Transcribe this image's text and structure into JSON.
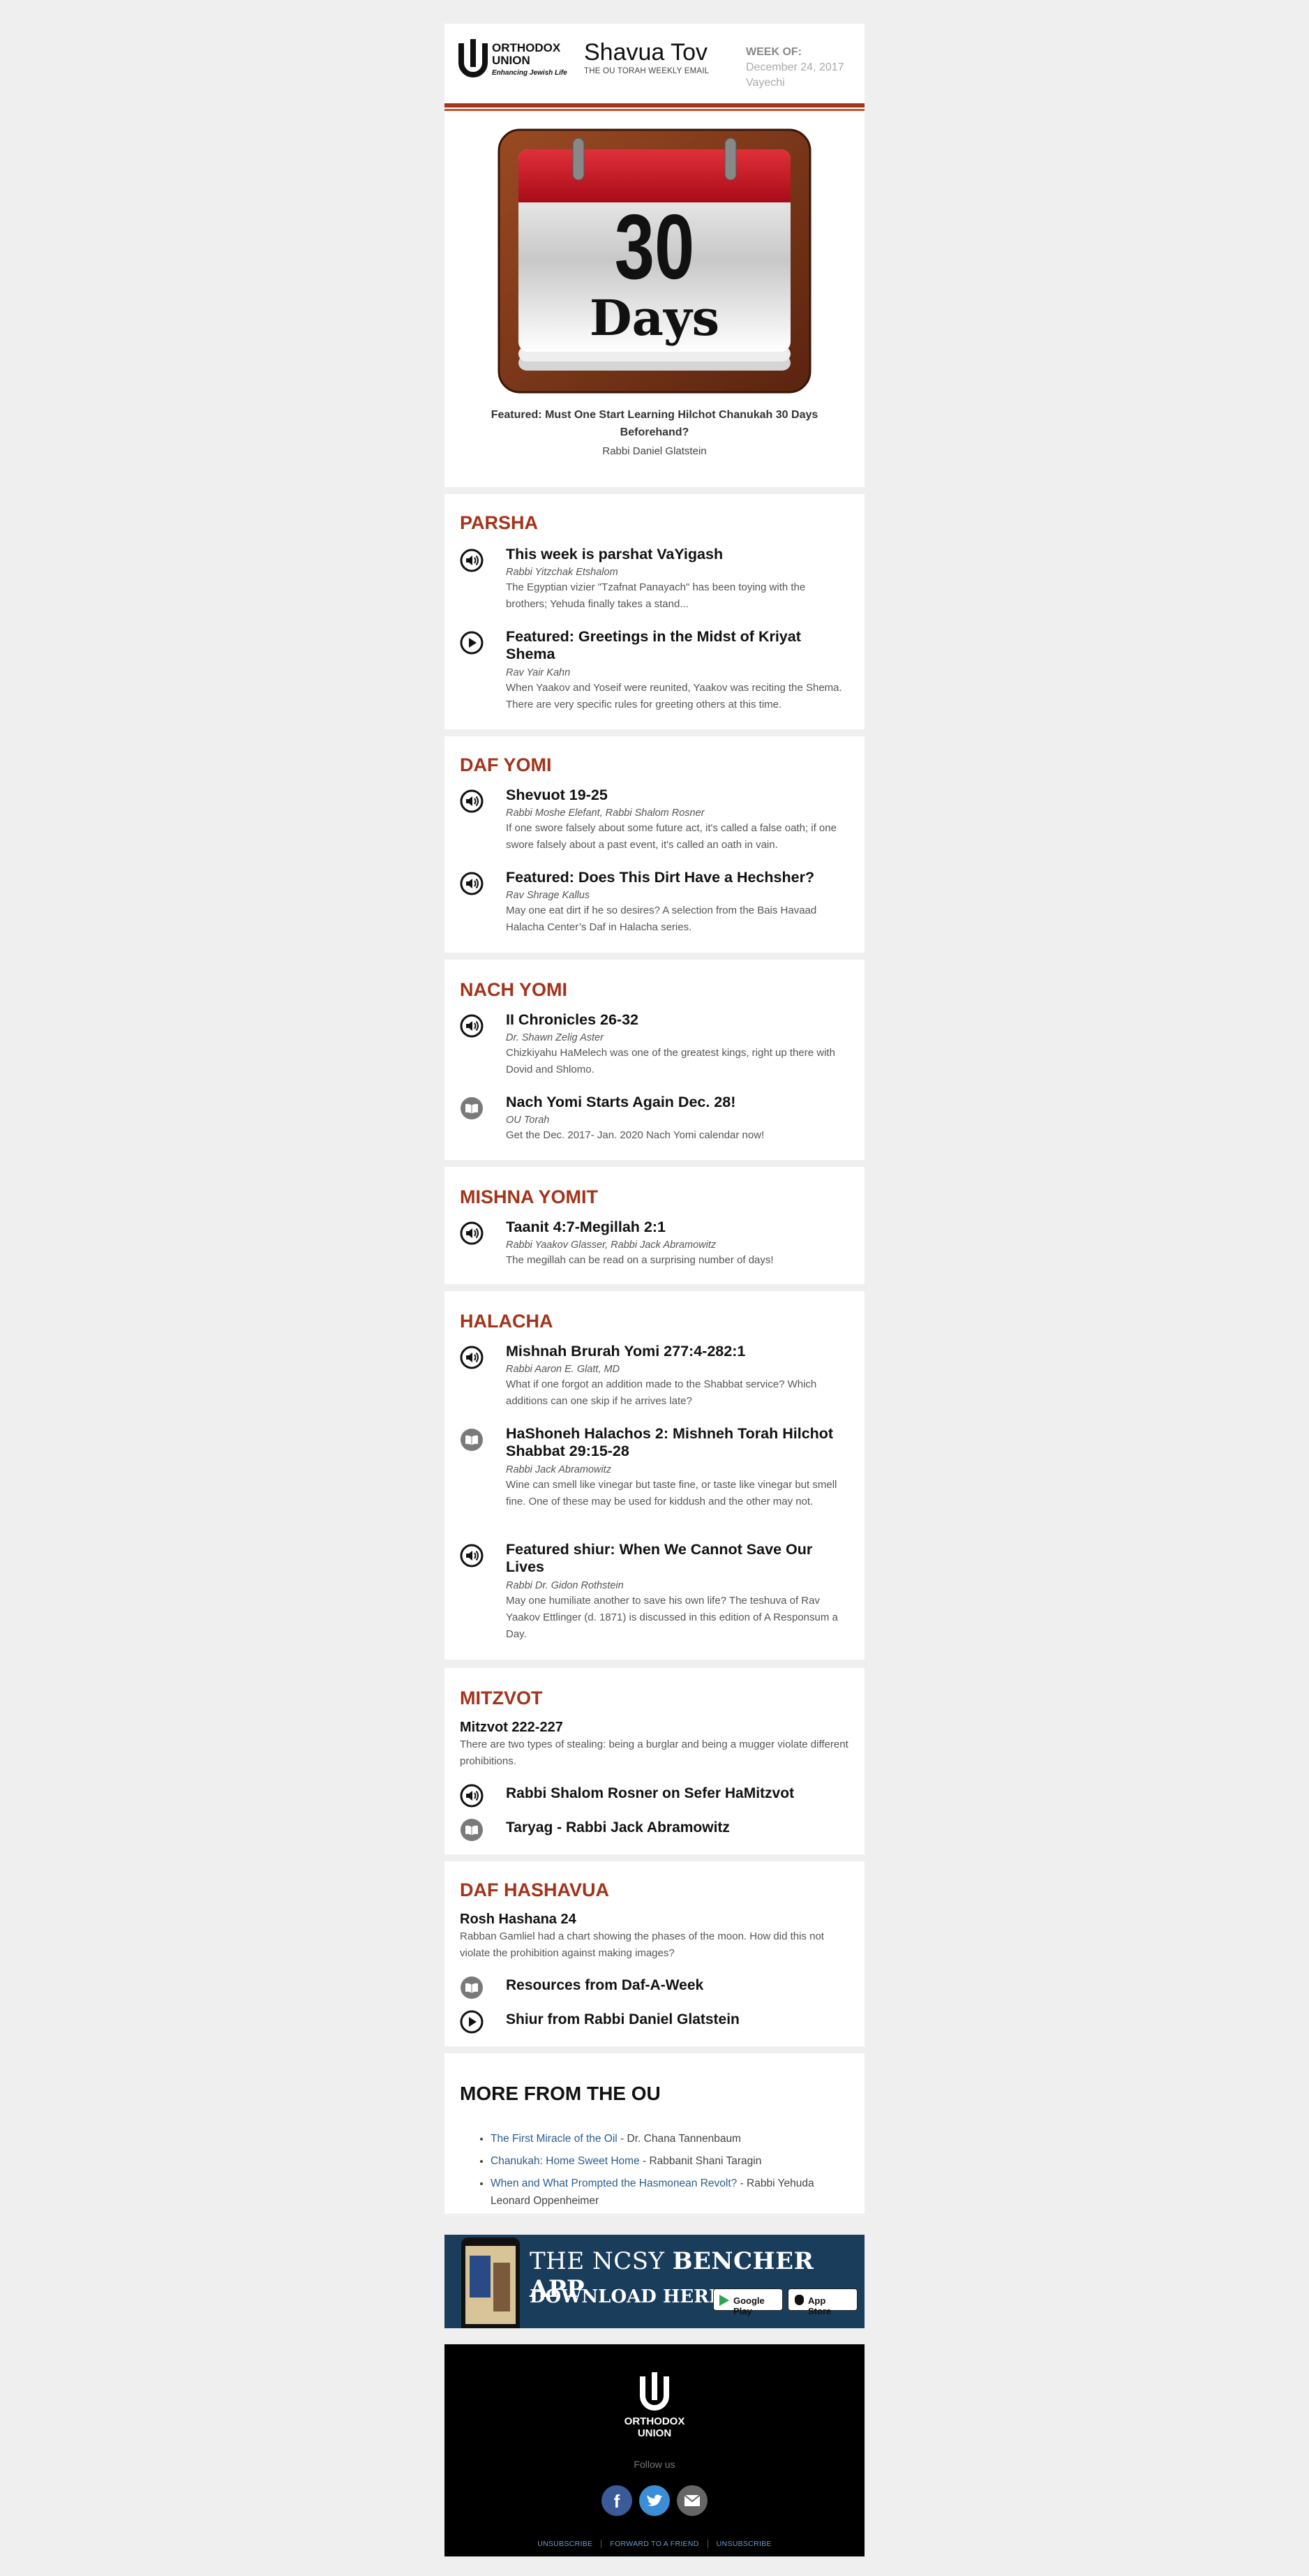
{
  "header": {
    "logo_line1": "ORTHODOX",
    "logo_line2": "UNION",
    "logo_tag": "Enhancing Jewish Life",
    "title": "Shavua Tov",
    "subtitle": "THE OU TORAH WEEKLY EMAIL",
    "week_label": "WEEK OF:",
    "week_date": "December 24, 2017",
    "week_parsha": "Vayechi"
  },
  "hero": {
    "number": "30",
    "word": "Days",
    "caption": "Featured: Must One Start Learning Hilchot Chanukah 30 Days Beforehand?",
    "author": "Rabbi Daniel Glatstein"
  },
  "sections": {
    "parsha": {
      "title": "PARSHA",
      "items": [
        {
          "icon": "audio-icon",
          "title": "This week is parshat VaYigash",
          "author": "Rabbi Yitzchak Etshalom",
          "desc": "The Egyptian vizier \"Tzafnat Panayach\" has been toying with the brothers; Yehuda finally takes a stand..."
        },
        {
          "icon": "play-icon",
          "title": "Featured: Greetings in the Midst of Kriyat Shema",
          "author": "Rav Yair Kahn",
          "desc": "When Yaakov and Yoseif were reunited, Yaakov was reciting the Shema. There are very specific rules for greeting others at this time."
        }
      ]
    },
    "daf_yomi": {
      "title": "DAF YOMI",
      "items": [
        {
          "icon": "audio-icon",
          "title": "Shevuot 19-25",
          "author": "Rabbi Moshe Elefant, Rabbi Shalom Rosner",
          "desc": "If one swore falsely about some future act, it's called a false oath; if one swore falsely about a past event, it's called an oath in vain."
        },
        {
          "icon": "audio-icon",
          "title": "Featured: Does This Dirt Have a Hechsher?",
          "author": "Rav Shrage Kallus",
          "desc": "May one eat dirt if he so desires? A selection from the Bais Havaad Halacha Center’s Daf in Halacha series."
        }
      ]
    },
    "nach_yomi": {
      "title": "NACH YOMI",
      "items": [
        {
          "icon": "audio-icon",
          "title": "II Chronicles 26-32",
          "author": "Dr. Shawn Zelig Aster",
          "desc": "Chizkiyahu HaMelech was one of the greatest kings, right up there with Dovid and Shlomo."
        },
        {
          "icon": "book-icon",
          "title": "Nach Yomi Starts Again Dec. 28!",
          "author": "OU Torah",
          "desc": "Get the Dec. 2017- Jan. 2020 Nach Yomi calendar now!"
        }
      ]
    },
    "mishna_yomit": {
      "title": "MISHNA YOMIT",
      "items": [
        {
          "icon": "audio-icon",
          "title": "Taanit 4:7-Megillah 2:1",
          "author": "Rabbi Yaakov Glasser, Rabbi Jack Abramowitz",
          "desc": "The megillah can be read on a surprising number of days!"
        }
      ]
    },
    "halacha": {
      "title": "HALACHA",
      "items": [
        {
          "icon": "audio-icon",
          "title": "Mishnah Brurah Yomi 277:4-282:1",
          "author": "Rabbi Aaron E. Glatt, MD",
          "desc": "What if one forgot an addition made to the Shabbat service? Which additions can one skip if he arrives late?"
        },
        {
          "icon": "book-icon",
          "title": "HaShoneh Halachos 2: Mishneh Torah Hilchot Shabbat 29:15-28",
          "author": "Rabbi Jack Abramowitz",
          "desc": "Wine can smell like vinegar but taste fine, or taste like vinegar but smell fine. One of these may be used for kiddush and the other may not."
        },
        {
          "icon": "audio-icon",
          "title": "Featured shiur: When We Cannot Save Our Lives",
          "author": "Rabbi Dr. Gidon Rothstein",
          "desc": "May one humiliate another to save his own life? The teshuva of Rav Yaakov Ettlinger (d. 1871) is discussed in this edition of A Responsum a Day."
        }
      ]
    },
    "mitzvot": {
      "title": "MITZVOT",
      "subtitle": "Mitzvot 222-227",
      "desc": "There are two types of stealing: being a burglar and being a mugger violate different prohibitions.",
      "links": [
        {
          "icon": "audio-icon",
          "label": "Rabbi Shalom Rosner on Sefer HaMitzvot"
        },
        {
          "icon": "book-icon",
          "label": "Taryag - Rabbi Jack Abramowitz"
        }
      ]
    },
    "daf_hashavua": {
      "title": "DAF HASHAVUA",
      "subtitle": "Rosh Hashana 24",
      "desc": "Rabban Gamliel had a chart showing the phases of the moon. How did this not violate the prohibition against making images?",
      "links": [
        {
          "icon": "book-icon",
          "label": "Resources from Daf-A-Week"
        },
        {
          "icon": "play-icon",
          "label": "Shiur from Rabbi Daniel Glatstein"
        }
      ]
    }
  },
  "more": {
    "title": "MORE FROM THE OU",
    "items": [
      {
        "link": "The First Miracle of the Oil",
        "author": "Dr. Chana Tannenbaum"
      },
      {
        "link": "Chanukah: Home Sweet Home",
        "author": "Rabbanit Shani Taragin"
      },
      {
        "link": "When and What Prompted the Hasmonean Revolt?",
        "author": "Rabbi Yehuda Leonard Oppenheimer"
      }
    ]
  },
  "banner": {
    "line1_a": "THE NCSY ",
    "line1_b": "BENCHER APP",
    "line2": "DOWNLOAD HERE",
    "google": "Google Play",
    "apple": "App Store"
  },
  "footer": {
    "logo_line1": "ORTHODOX",
    "logo_line2": "UNION",
    "follow": "Follow us",
    "links": [
      "UNSUBSCRIBE",
      "FORWARD TO A FRIEND",
      "UNSUBSCRIBE"
    ]
  },
  "colors": {
    "accent": "#a3331b",
    "link": "#2a5d8f",
    "banner": "#1a3d5c"
  }
}
